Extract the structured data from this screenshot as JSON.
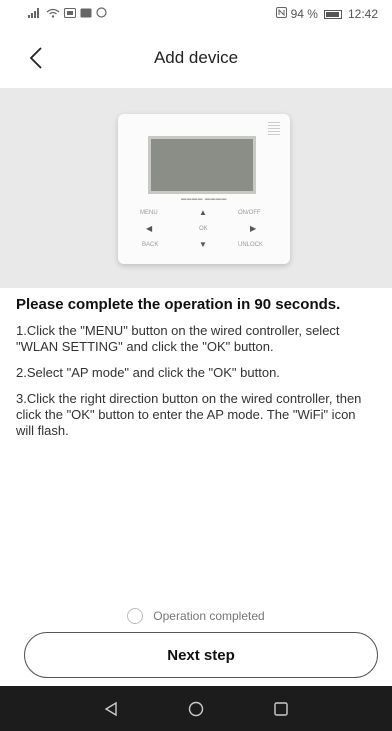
{
  "status_bar": {
    "battery_text": "94 %",
    "time": "12:42"
  },
  "header": {
    "title": "Add device",
    "back_icon": "chevron-left-icon"
  },
  "controller": {
    "labels": {
      "menu": "MENU",
      "on_off": "ON/OFF",
      "ok": "OK",
      "back": "BACK",
      "unlock": "UNLOCK"
    }
  },
  "instructions": {
    "warning": "Please complete the operation in 90 seconds.",
    "steps": [
      "1.Click the \"MENU\" button on the wired controller, select \"WLAN SETTING\" and click the \"OK\" button.",
      "2.Select \"AP mode\" and click the \"OK\" button.",
      "3.Click the right direction button on the wired controller, then click the \"OK\" button to enter the AP mode. The \"WiFi\" icon will flash."
    ]
  },
  "completion": {
    "label": "Operation completed",
    "checked": false
  },
  "next_button": {
    "label": "Next step"
  },
  "colors": {
    "hero_background": "#e9e9e9",
    "nav_bar": "#1c1c1c",
    "text": "#222222"
  }
}
